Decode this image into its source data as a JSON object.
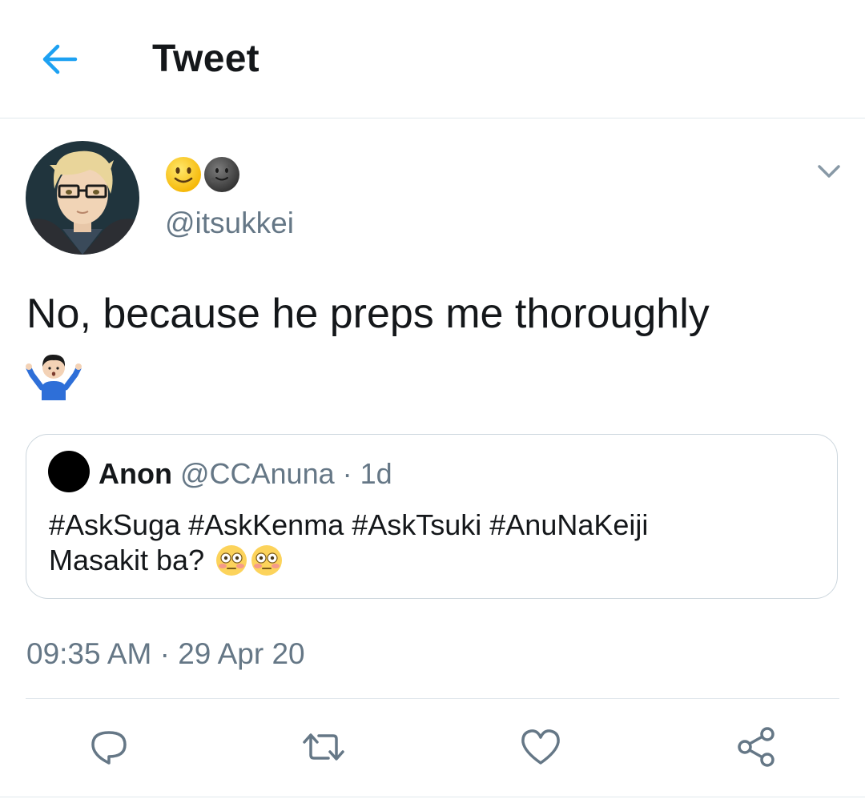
{
  "header": {
    "title": "Tweet"
  },
  "tweet": {
    "display_name_emoji": [
      "slightly-smiling-face",
      "new-moon-face"
    ],
    "handle": "@itsukkei",
    "text": "No, because he preps me thoroughly",
    "text_emoji": "person-shrugging",
    "timestamp": "09:35 AM · 29 Apr 20"
  },
  "quoted": {
    "name": "Anon",
    "handle": "@CCAnuna",
    "separator": " · ",
    "age": "1d",
    "hashtags": "#AskSuga #AskKenma #AskTsuki #AnuNaKeiji",
    "text": "Masakit ba?",
    "emoji": [
      "flushed-face",
      "flushed-face"
    ]
  },
  "colors": {
    "accent": "#1da1f2",
    "secondary_text": "#657786",
    "border": "#e1e8ed"
  },
  "actions": [
    "reply-icon",
    "retweet-icon",
    "like-icon",
    "share-icon"
  ]
}
